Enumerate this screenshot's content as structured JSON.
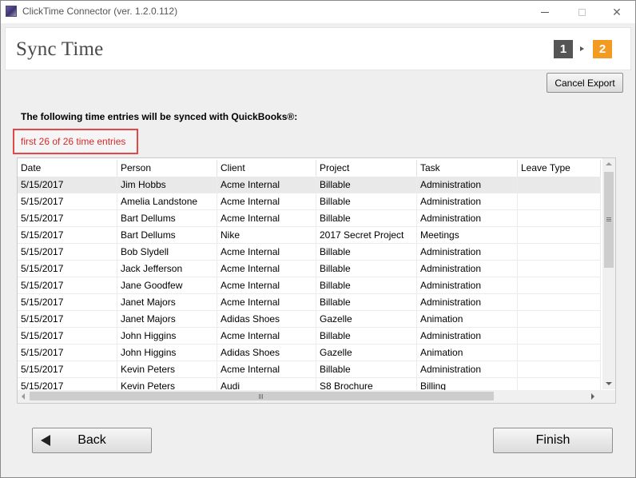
{
  "window": {
    "title": "ClickTime Connector (ver. 1.2.0.112)",
    "controls": {
      "minimize": "minimize-icon",
      "maximize": "maximize-icon",
      "close": "✕"
    }
  },
  "header": {
    "title": "Sync Time",
    "steps": [
      "1",
      "2"
    ],
    "active_step": "2",
    "colors": {
      "step_inactive": "#555555",
      "step_active": "#f39a23"
    }
  },
  "actions": {
    "cancel_label": "Cancel Export",
    "back_label": "Back",
    "finish_label": "Finish"
  },
  "intro_text": "The following time entries will be synced with QuickBooks®:",
  "count_text": "first 26 of 26 time entries",
  "grid": {
    "columns": [
      "Date",
      "Person",
      "Client",
      "Project",
      "Task",
      "Leave Type"
    ],
    "rows": [
      [
        "5/15/2017",
        "Jim Hobbs",
        "Acme Internal",
        "Billable",
        "Administration",
        ""
      ],
      [
        "5/15/2017",
        "Amelia Landstone",
        "Acme Internal",
        "Billable",
        "Administration",
        ""
      ],
      [
        "5/15/2017",
        "Bart Dellums",
        "Acme Internal",
        "Billable",
        "Administration",
        ""
      ],
      [
        "5/15/2017",
        "Bart Dellums",
        "Nike",
        "2017 Secret Project",
        "Meetings",
        ""
      ],
      [
        "5/15/2017",
        "Bob Slydell",
        "Acme Internal",
        "Billable",
        "Administration",
        ""
      ],
      [
        "5/15/2017",
        "Jack Jefferson",
        "Acme Internal",
        "Billable",
        "Administration",
        ""
      ],
      [
        "5/15/2017",
        "Jane Goodfew",
        "Acme Internal",
        "Billable",
        "Administration",
        ""
      ],
      [
        "5/15/2017",
        "Janet Majors",
        "Acme Internal",
        "Billable",
        "Administration",
        ""
      ],
      [
        "5/15/2017",
        "Janet Majors",
        "Adidas Shoes",
        "Gazelle",
        "Animation",
        ""
      ],
      [
        "5/15/2017",
        "John Higgins",
        "Acme Internal",
        "Billable",
        "Administration",
        ""
      ],
      [
        "5/15/2017",
        "John Higgins",
        "Adidas Shoes",
        "Gazelle",
        "Animation",
        ""
      ],
      [
        "5/15/2017",
        "Kevin Peters",
        "Acme Internal",
        "Billable",
        "Administration",
        ""
      ],
      [
        "5/15/2017",
        "Kevin Peters",
        "Audi",
        "S8 Brochure",
        "Billing",
        ""
      ]
    ],
    "selected_row": 0
  },
  "colors": {
    "highlight_border": "#e0484a",
    "highlight_text": "#d8282a"
  }
}
